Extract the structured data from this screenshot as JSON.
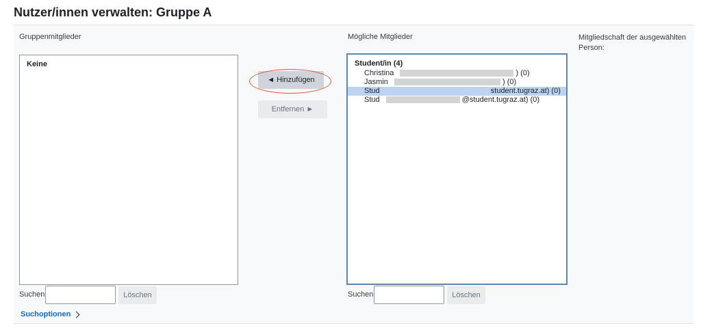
{
  "page": {
    "title": "Nutzer/innen verwalten: Gruppe A"
  },
  "members": {
    "label": "Gruppenmitglieder",
    "empty_label": "Keine",
    "search_label": "Suchen",
    "search_value": "",
    "clear_label": "Löschen",
    "search_options_label": "Suchoptionen"
  },
  "actions": {
    "add_label": "◄ Hinzufügen",
    "remove_label": "Entfernen ►"
  },
  "potential": {
    "label": "Mögliche Mitglieder",
    "group_label": "Student/in (4)",
    "options": [
      {
        "prefix": "Christina",
        "suffix": ") (0)",
        "selected": false
      },
      {
        "prefix": "Jasmin",
        "suffix": ") (0)",
        "selected": false
      },
      {
        "prefix": "Stud",
        "suffix": "student.tugraz.at) (0)",
        "selected": true
      },
      {
        "prefix": "Stud",
        "suffix": "@student.tugraz.at) (0)",
        "selected": false
      }
    ],
    "search_label": "Suchen",
    "search_value": "",
    "clear_label": "Löschen"
  },
  "membership": {
    "label": "Mitgliedschaft der ausgewählten Person:"
  },
  "colors": {
    "accent": "#0f6cbf",
    "annotation": "#d9543b",
    "selection": "#bcd3f2"
  }
}
